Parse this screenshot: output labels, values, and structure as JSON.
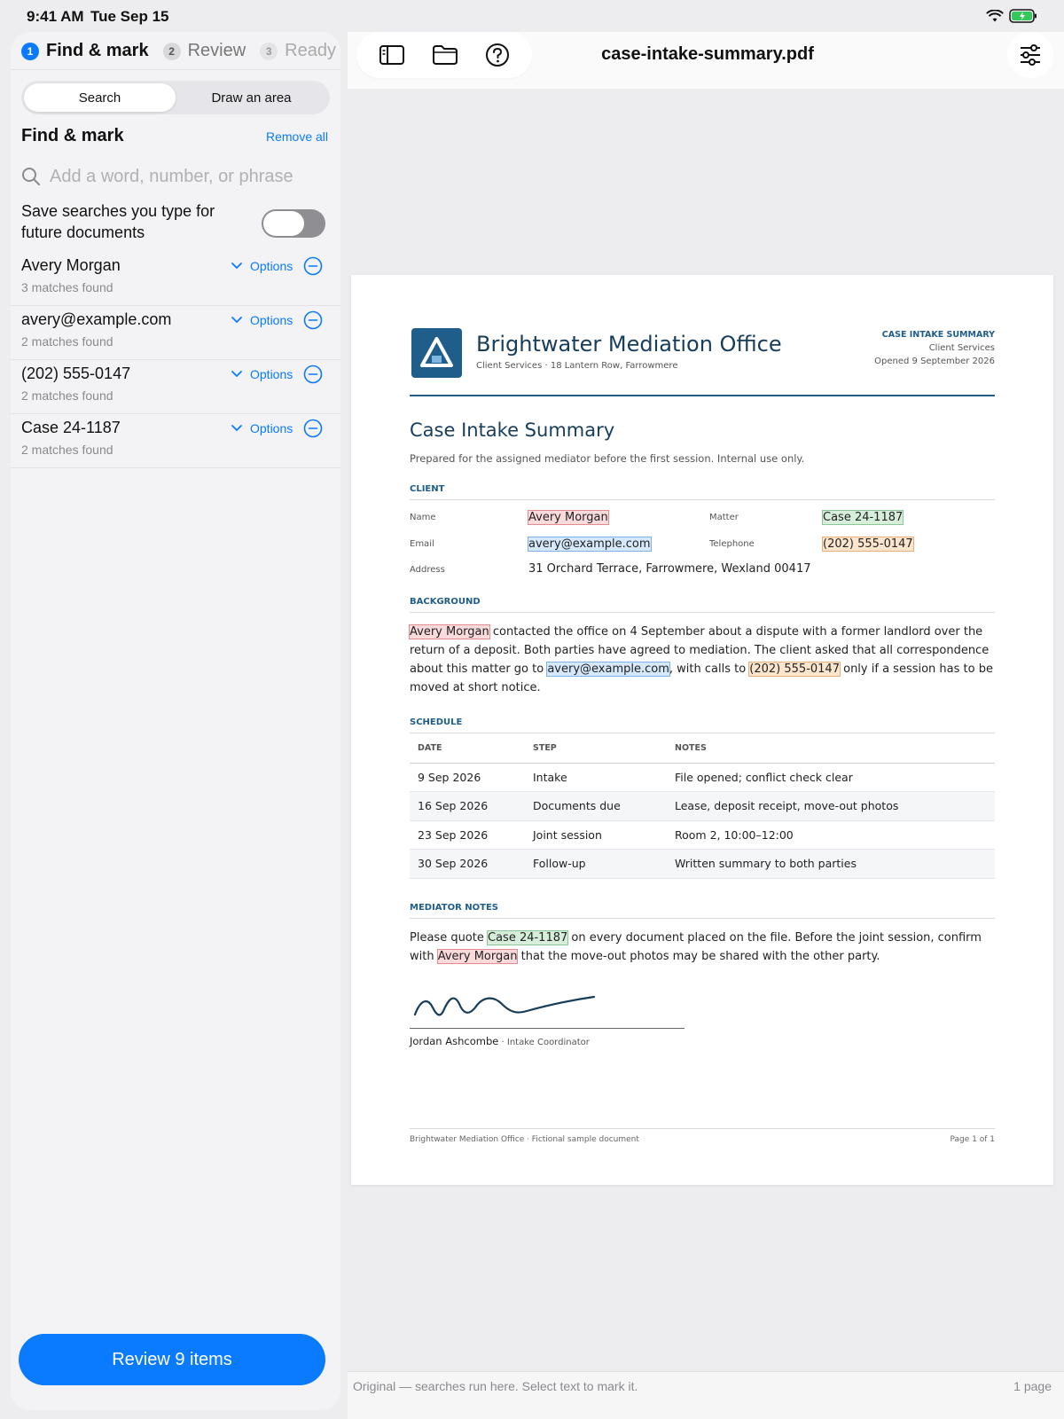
{
  "status_bar": {
    "time": "9:41 AM",
    "date": "Tue Sep 15"
  },
  "steps": [
    {
      "number": "1",
      "label": "Find & mark"
    },
    {
      "number": "2",
      "label": "Review"
    },
    {
      "number": "3",
      "label": "Ready"
    }
  ],
  "mode_tabs": {
    "search": "Search",
    "draw": "Draw an area"
  },
  "find_mark": {
    "title": "Find & mark",
    "remove_all": "Remove all",
    "search_placeholder": "Add a word, number, or phrase",
    "save_searches_label": "Save searches you type for future documents",
    "save_searches_on": false,
    "options_label": "Options",
    "terms": [
      {
        "name": "Avery Morgan",
        "count": "3 matches found"
      },
      {
        "name": "avery@example.com",
        "count": "2 matches found"
      },
      {
        "name": "(202) 555-0147",
        "count": "2 matches found"
      },
      {
        "name": "Case 24-1187",
        "count": "2 matches found"
      }
    ],
    "review_button": "Review 9 items"
  },
  "toolbar": {
    "filename": "case-intake-summary.pdf"
  },
  "colors": {
    "accent": "#0a7aff",
    "doc_blue": "#1f5d8a",
    "hl_red": "#fbdadc",
    "hl_blue": "#d6e8fb",
    "hl_green": "#d7eedb",
    "hl_orange": "#fbe5cd"
  },
  "document": {
    "org_name": "Brightwater Mediation Office",
    "org_sub": "Client Services · 18 Lantern Row, Farrowmere",
    "header_right": {
      "kind": "CASE INTAKE SUMMARY",
      "dept": "Client Services",
      "opened": "Opened 9 September 2026"
    },
    "title": "Case Intake Summary",
    "subtitle": "Prepared for the assigned mediator before the first session. Internal use only.",
    "client": {
      "heading": "CLIENT",
      "name_label": "Name",
      "name": "Avery Morgan",
      "matter_label": "Matter",
      "matter": "Case 24-1187",
      "email_label": "Email",
      "email": "avery@example.com",
      "phone_label": "Telephone",
      "phone": "(202) 555-0147",
      "address_label": "Address",
      "address": "31 Orchard Terrace, Farrowmere, Wexland 00417"
    },
    "background": {
      "heading": "BACKGROUND",
      "name": "Avery Morgan",
      "t1": " contacted the office on 4 September about a dispute with a former landlord over the return of a deposit. Both parties have agreed to mediation. The client asked that all correspondence about this matter go to ",
      "email": "avery@example.com",
      "t2": ", with calls to ",
      "phone": "(202) 555-0147",
      "t3": " only if a session has to be moved at short notice."
    },
    "schedule": {
      "heading": "SCHEDULE",
      "columns": [
        "DATE",
        "STEP",
        "NOTES"
      ],
      "rows": [
        [
          "9 Sep 2026",
          "Intake",
          "File opened; conflict check clear"
        ],
        [
          "16 Sep 2026",
          "Documents due",
          "Lease, deposit receipt, move-out photos"
        ],
        [
          "23 Sep 2026",
          "Joint session",
          "Room 2, 10:00–12:00"
        ],
        [
          "30 Sep 2026",
          "Follow-up",
          "Written summary to both parties"
        ]
      ]
    },
    "notes": {
      "heading": "MEDIATOR NOTES",
      "t1": "Please quote ",
      "case": "Case 24-1187",
      "t2": " on every document placed on the file. Before the joint session, confirm with ",
      "name": "Avery Morgan",
      "t3": " that the move-out photos may be shared with the other party."
    },
    "signer": {
      "name": "Jordan Ashcombe",
      "role": " · Intake Coordinator"
    },
    "footer_left": "Brightwater Mediation Office · Fictional sample document",
    "footer_right": "Page 1 of 1"
  },
  "bottom_bar": {
    "info": "Original — searches run here. Select text to mark it.",
    "pages": "1 page"
  }
}
